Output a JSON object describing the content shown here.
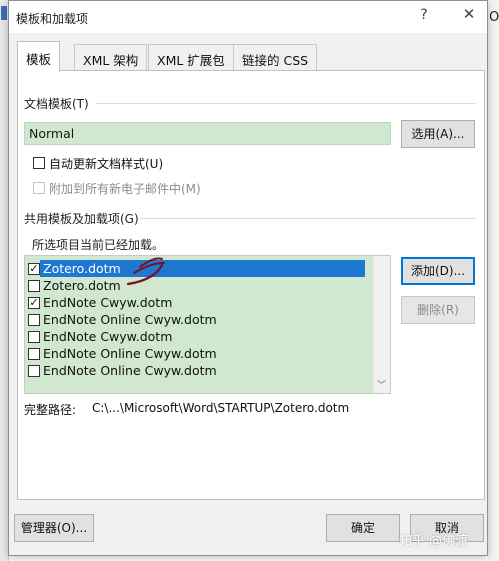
{
  "window": {
    "title": "模板和加载项",
    "help_glyph": "?",
    "close_glyph": "✕"
  },
  "background": {
    "partial_glyph": "O"
  },
  "tabs": [
    {
      "label": "模板",
      "active": true
    },
    {
      "label": "XML 架构",
      "active": false
    },
    {
      "label": "XML 扩展包",
      "active": false
    },
    {
      "label": "链接的 CSS",
      "active": false
    }
  ],
  "document_template": {
    "section_label": "文档模板(T)",
    "value": "Normal",
    "attach_button": "选用(A)..."
  },
  "options": {
    "auto_update": {
      "label": "自动更新文档样式(U)",
      "checked": false,
      "enabled": true
    },
    "attach_to_email": {
      "label": "附加到所有新电子邮件中(M)",
      "checked": false,
      "enabled": false
    }
  },
  "global_templates": {
    "section_label": "共用模板及加载项(G)",
    "hint": "所选项目当前已经加载。",
    "items": [
      {
        "label": "Zotero.dotm",
        "checked": true,
        "selected": true
      },
      {
        "label": "Zotero.dotm",
        "checked": false,
        "selected": false
      },
      {
        "label": "EndNote Cwyw.dotm",
        "checked": true,
        "selected": false
      },
      {
        "label": "EndNote Online Cwyw.dotm",
        "checked": false,
        "selected": false
      },
      {
        "label": "EndNote Cwyw.dotm",
        "checked": false,
        "selected": false
      },
      {
        "label": "EndNote Online Cwyw.dotm",
        "checked": false,
        "selected": false
      },
      {
        "label": "EndNote Online Cwyw.dotm",
        "checked": false,
        "selected": false
      }
    ],
    "add_button": "添加(D)...",
    "remove_button": "删除(R)",
    "path_label": "完整路径:",
    "path_value": "C:\\...\\Microsoft\\Word\\STARTUP\\Zotero.dotm"
  },
  "footer": {
    "organizer_button": "管理器(O)...",
    "ok_button": "确定",
    "cancel_button": "取消"
  },
  "watermark": "知乎 @佛渡",
  "colors": {
    "field_green": "#cfe8cf",
    "selection_blue": "#1e78d2",
    "annotation_ink": "#7a1020",
    "default_button_border": "#0078d7"
  }
}
